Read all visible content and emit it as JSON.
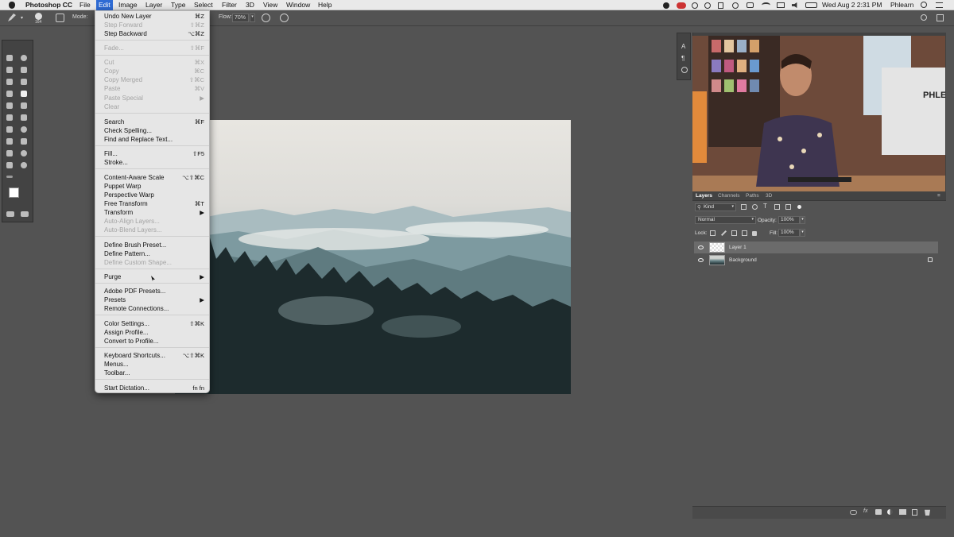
{
  "menubar": {
    "app_name": "Photoshop CC",
    "menus": [
      "File",
      "Edit",
      "Image",
      "Layer",
      "Type",
      "Select",
      "Filter",
      "3D",
      "View",
      "Window",
      "Help"
    ],
    "active_menu": "Edit",
    "clock": "Wed Aug 2  2:31 PM",
    "user": "Phlearn"
  },
  "options_bar": {
    "mode_label": "Mode:",
    "brush_size": "164",
    "flow_label": "Flow:",
    "flow_value": "70%"
  },
  "edit_menu": {
    "items": [
      {
        "label": "Undo New Layer",
        "shortcut": "⌘Z",
        "enabled": true
      },
      {
        "label": "Step Forward",
        "shortcut": "⇧⌘Z",
        "enabled": false
      },
      {
        "label": "Step Backward",
        "shortcut": "⌥⌘Z",
        "enabled": true
      },
      {
        "label": "Fade...",
        "shortcut": "⇧⌘F",
        "enabled": false
      },
      {
        "label": "Cut",
        "shortcut": "⌘X",
        "enabled": false
      },
      {
        "label": "Copy",
        "shortcut": "⌘C",
        "enabled": false
      },
      {
        "label": "Copy Merged",
        "shortcut": "⇧⌘C",
        "enabled": false
      },
      {
        "label": "Paste",
        "shortcut": "⌘V",
        "enabled": false
      },
      {
        "label": "Paste Special",
        "shortcut": "▶",
        "enabled": false
      },
      {
        "label": "Clear",
        "shortcut": "",
        "enabled": false
      },
      {
        "label": "Search",
        "shortcut": "⌘F",
        "enabled": true
      },
      {
        "label": "Check Spelling...",
        "shortcut": "",
        "enabled": true
      },
      {
        "label": "Find and Replace Text...",
        "shortcut": "",
        "enabled": true
      },
      {
        "label": "Fill...",
        "shortcut": "⇧F5",
        "enabled": true
      },
      {
        "label": "Stroke...",
        "shortcut": "",
        "enabled": true
      },
      {
        "label": "Content-Aware Scale",
        "shortcut": "⌥⇧⌘C",
        "enabled": true
      },
      {
        "label": "Puppet Warp",
        "shortcut": "",
        "enabled": true
      },
      {
        "label": "Perspective Warp",
        "shortcut": "",
        "enabled": true
      },
      {
        "label": "Free Transform",
        "shortcut": "⌘T",
        "enabled": true
      },
      {
        "label": "Transform",
        "shortcut": "▶",
        "enabled": true
      },
      {
        "label": "Auto-Align Layers...",
        "shortcut": "",
        "enabled": false
      },
      {
        "label": "Auto-Blend Layers...",
        "shortcut": "",
        "enabled": false
      },
      {
        "label": "Define Brush Preset...",
        "shortcut": "",
        "enabled": true
      },
      {
        "label": "Define Pattern...",
        "shortcut": "",
        "enabled": true
      },
      {
        "label": "Define Custom Shape...",
        "shortcut": "",
        "enabled": false
      },
      {
        "label": "Purge",
        "shortcut": "▶",
        "enabled": true
      },
      {
        "label": "Adobe PDF Presets...",
        "shortcut": "",
        "enabled": true
      },
      {
        "label": "Presets",
        "shortcut": "▶",
        "enabled": true
      },
      {
        "label": "Remote Connections...",
        "shortcut": "",
        "enabled": true
      },
      {
        "label": "Color Settings...",
        "shortcut": "⇧⌘K",
        "enabled": true
      },
      {
        "label": "Assign Profile...",
        "shortcut": "",
        "enabled": true
      },
      {
        "label": "Convert to Profile...",
        "shortcut": "",
        "enabled": true
      },
      {
        "label": "Keyboard Shortcuts...",
        "shortcut": "⌥⇧⌘K",
        "enabled": true
      },
      {
        "label": "Menus...",
        "shortcut": "",
        "enabled": true
      },
      {
        "label": "Toolbar...",
        "shortcut": "",
        "enabled": true
      },
      {
        "label": "Start Dictation...",
        "shortcut": "fn fn",
        "enabled": true
      }
    ]
  },
  "layers_panel": {
    "tabs": [
      "Layers",
      "Channels",
      "Paths",
      "3D"
    ],
    "active_tab": "Layers",
    "filter_kind": "Kind",
    "blend_mode": "Normal",
    "opacity_label": "Opacity:",
    "opacity_value": "100%",
    "lock_label": "Lock:",
    "fill_label": "Fill:",
    "fill_value": "100%",
    "layers": [
      {
        "name": "Layer 1",
        "selected": true,
        "locked": false
      },
      {
        "name": "Background",
        "selected": false,
        "locked": true
      }
    ]
  },
  "video_overlay": {
    "sign_text": "PHLEA"
  },
  "colors": {
    "accent_blue": "#2e6bd4",
    "panel_bg": "#535353",
    "menu_bg": "#e6e6e6"
  }
}
